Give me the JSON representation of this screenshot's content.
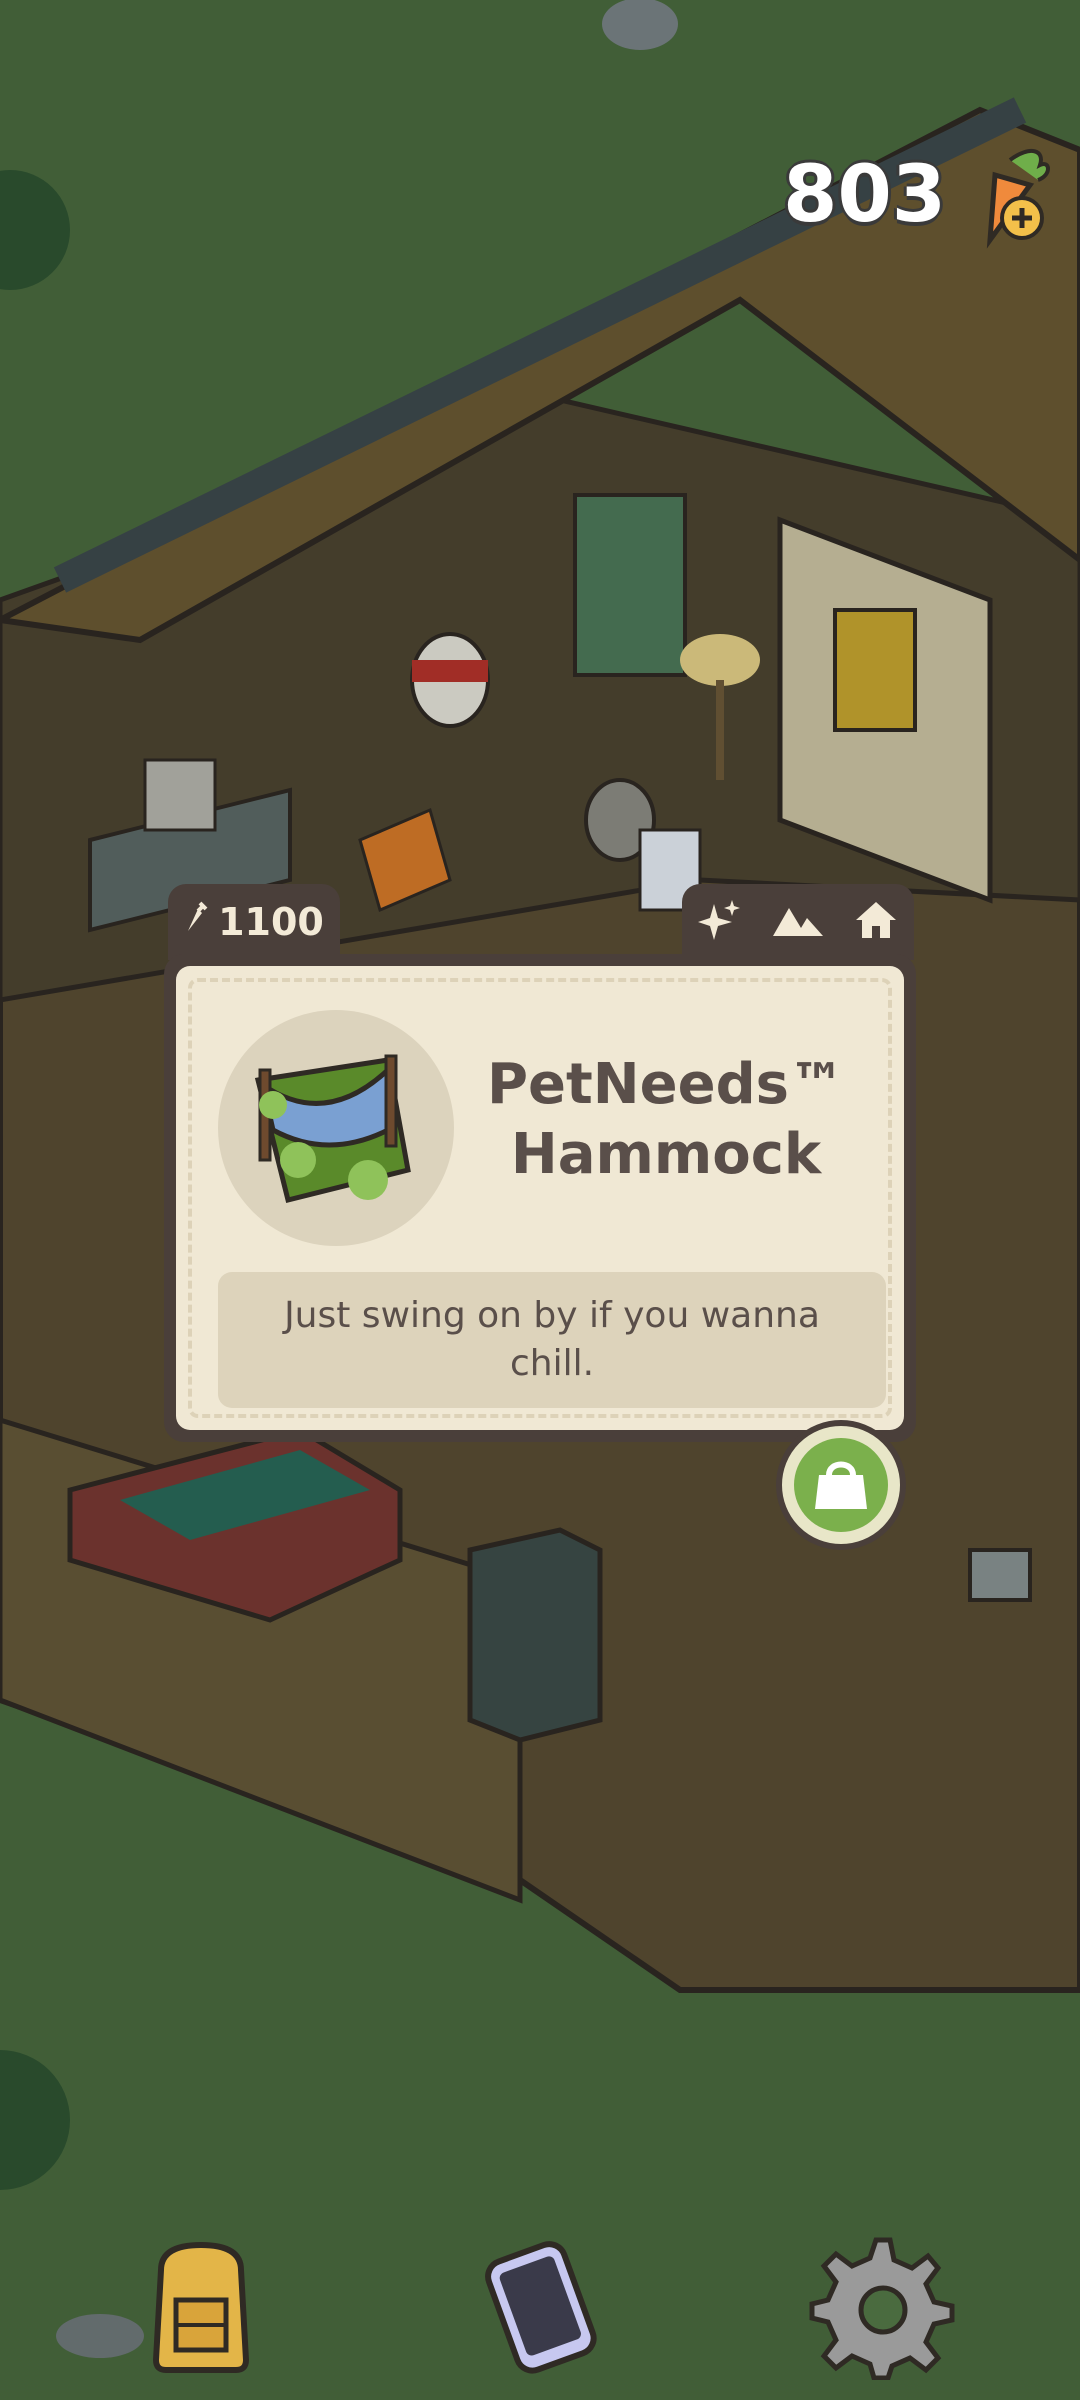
{
  "currency": {
    "amount": "803",
    "icon": "carrot-add-icon"
  },
  "item_card": {
    "price": "1100",
    "price_icon": "carrot-icon",
    "tag_icons": [
      "sparkle-icon",
      "mountains-icon",
      "home-icon"
    ],
    "name": "PetNeeds™ Hammock",
    "description": "Just swing on by if you wanna chill.",
    "thumbnail": "hammock-icon"
  },
  "buy_button": {
    "icon": "shopping-bag-icon"
  },
  "bottom_nav": {
    "items": [
      {
        "id": "backpack",
        "icon": "backpack-icon"
      },
      {
        "id": "phone",
        "icon": "phone-icon"
      },
      {
        "id": "settings",
        "icon": "gear-icon"
      }
    ]
  },
  "colors": {
    "grass": "#4a6b3f",
    "card_frame": "#4a3f3a",
    "card_bg": "#f0e8d4",
    "text": "#5a4f4a",
    "buy_green": "#7bb04c"
  }
}
